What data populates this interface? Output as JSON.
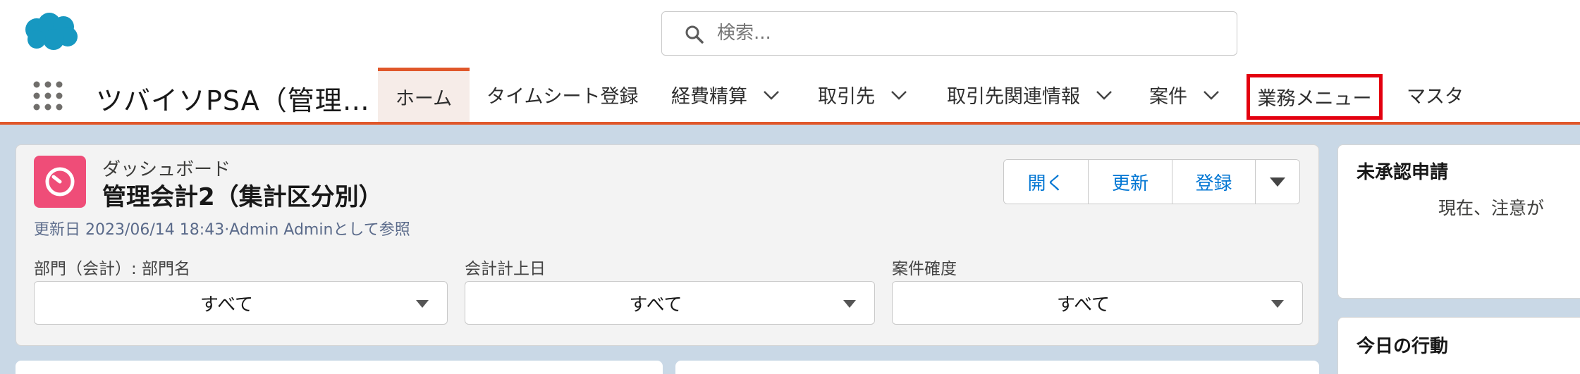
{
  "search": {
    "placeholder": "検索..."
  },
  "nav": {
    "app_name": "ツバイソPSA（管理…",
    "tabs": [
      {
        "label": "ホーム",
        "active": true
      },
      {
        "label": "タイムシート登録"
      },
      {
        "label": "経費精算",
        "has_menu": true
      },
      {
        "label": "取引先",
        "has_menu": true
      },
      {
        "label": "取引先関連情報",
        "has_menu": true
      },
      {
        "label": "案件",
        "has_menu": true
      },
      {
        "label": "業務メニュー",
        "highlighted": true
      },
      {
        "label": "マスタ"
      }
    ]
  },
  "dashboard": {
    "type_label": "ダッシュボード",
    "title": "管理会計2（集計区分別）",
    "meta": "更新日 2023/06/14 18:43·Admin Adminとして参照",
    "buttons": {
      "open": "開く",
      "refresh": "更新",
      "register": "登録"
    },
    "filters": [
      {
        "label": "部門（会計）: 部門名",
        "value": "すべて"
      },
      {
        "label": "会計計上日",
        "value": "すべて"
      },
      {
        "label": "案件確度",
        "value": "すべて"
      }
    ]
  },
  "sidebar": {
    "pending_title": "未承認申請",
    "pending_text": "現在、注意が",
    "today_title": "今日の行動"
  },
  "colors": {
    "accent": "#e0572a",
    "brand_blue": "#1798c1",
    "link_blue": "#0176d3",
    "dashboard_icon": "#ef4d78",
    "highlight_red": "#e3000f"
  },
  "icons": [
    "salesforce-cloud-logo",
    "search-icon",
    "app-launcher-grid-icon",
    "chevron-down-icon",
    "dashboard-gauge-icon",
    "dropdown-arrow-icon"
  ]
}
